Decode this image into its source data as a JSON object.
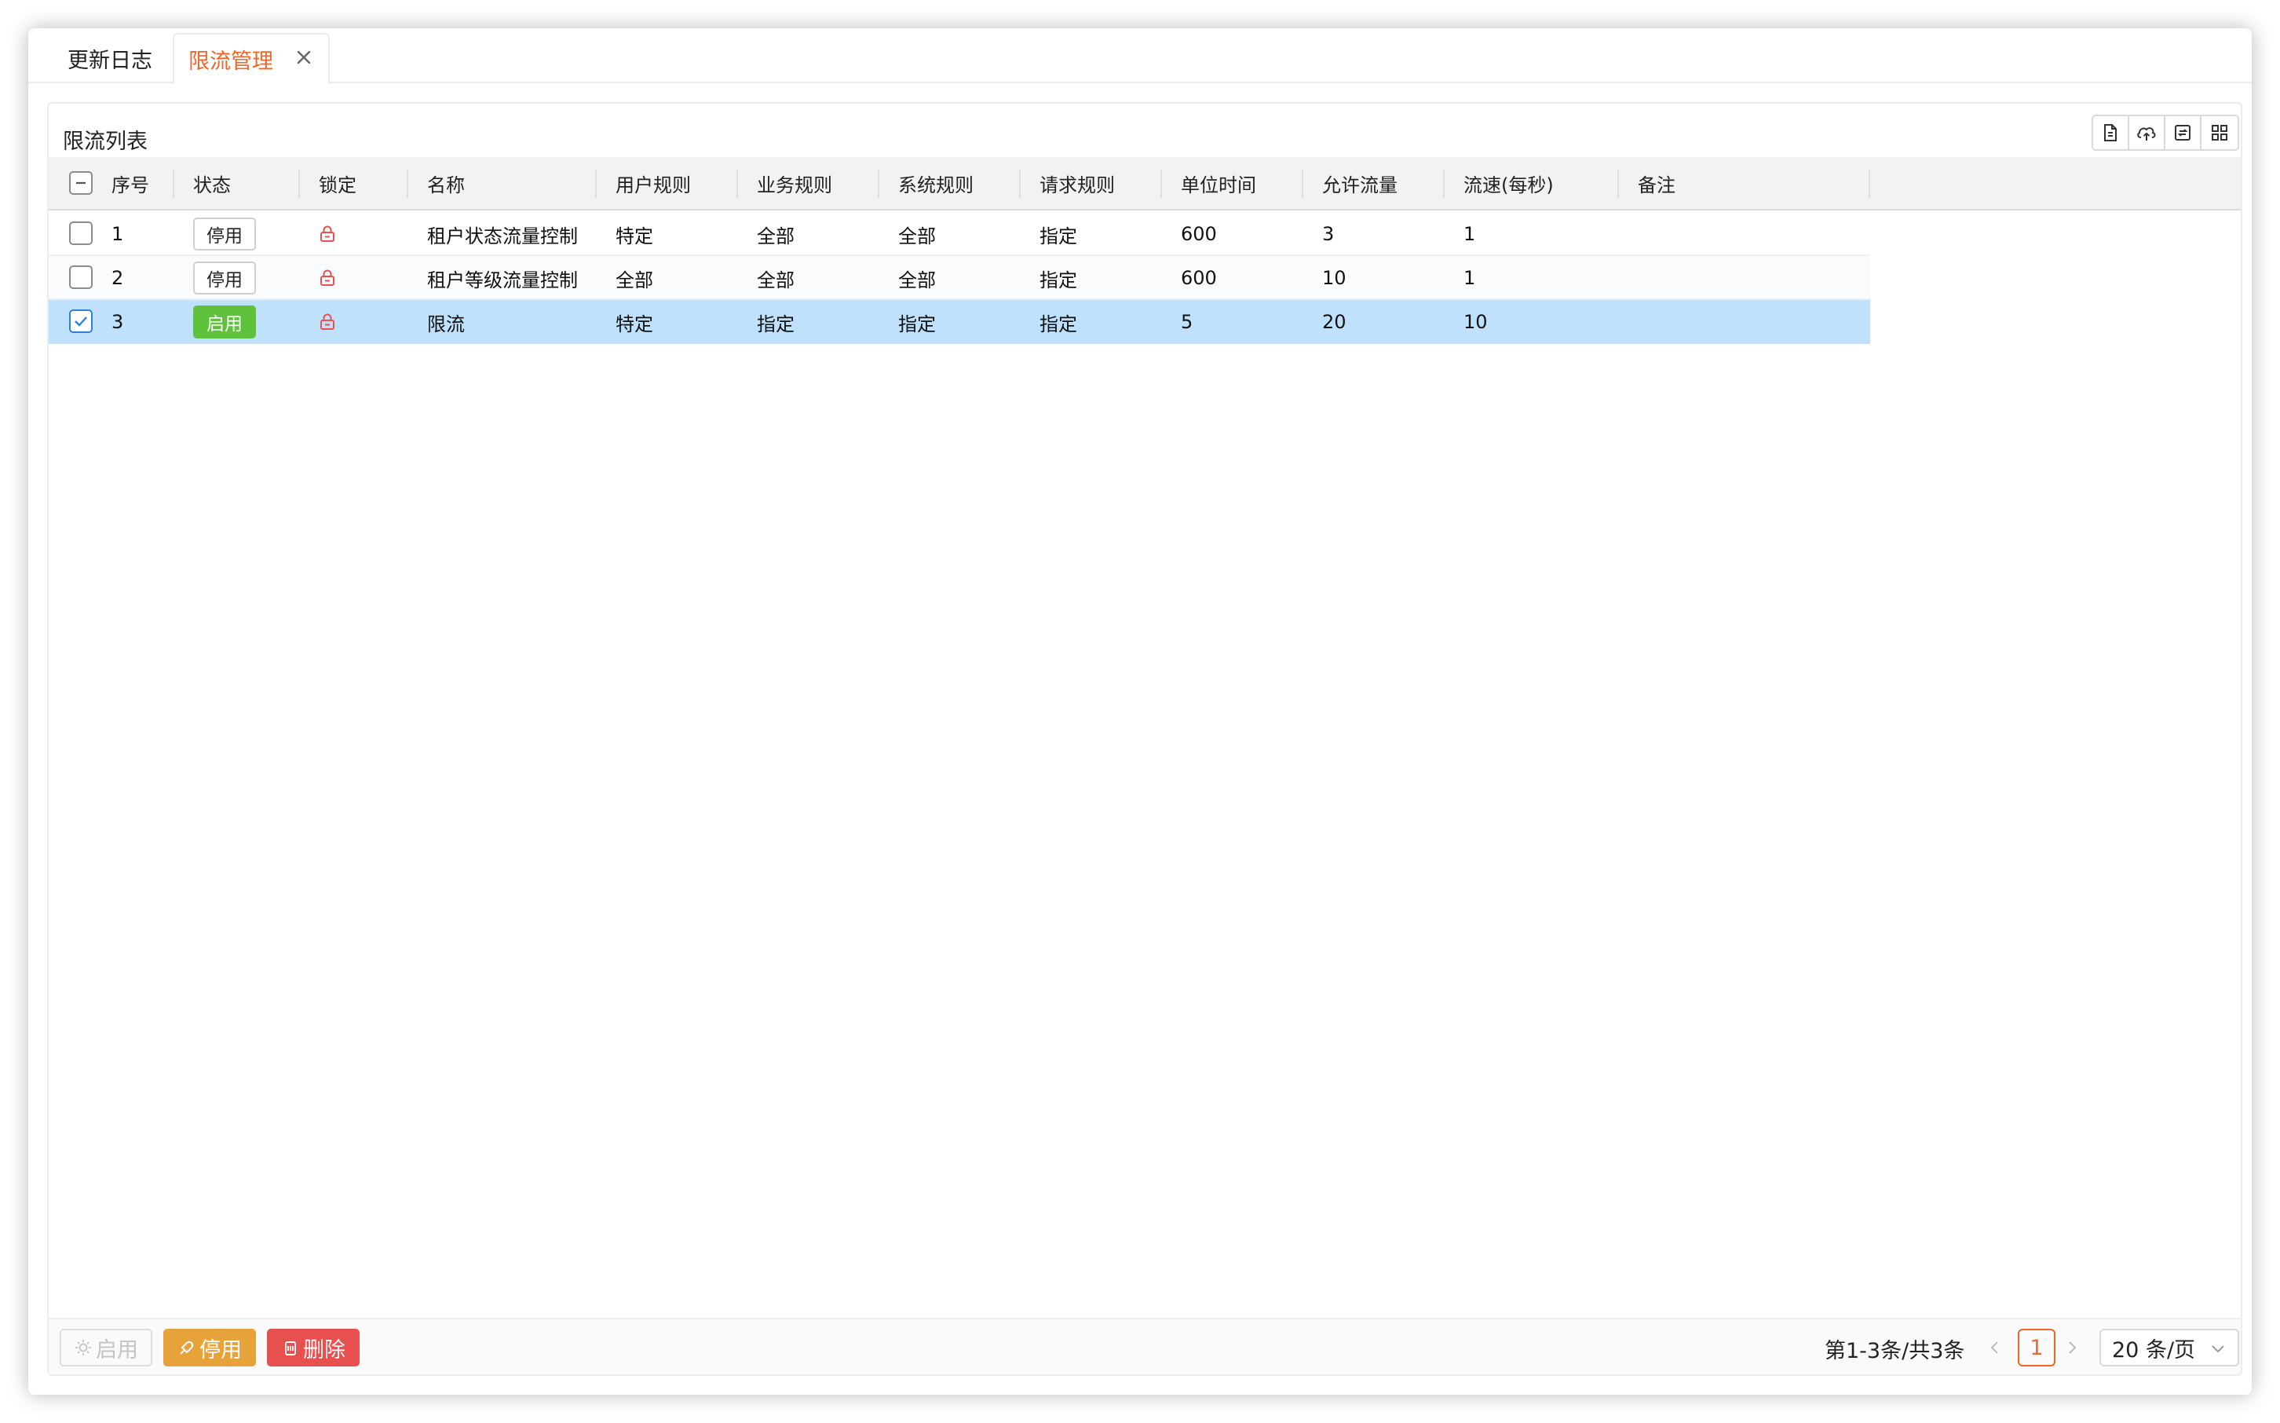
{
  "tabs": [
    {
      "label": "更新日志",
      "active": false
    },
    {
      "label": "限流管理",
      "active": true
    }
  ],
  "panel": {
    "title": "限流列表",
    "toolbar_icons": [
      "export-file-icon",
      "cloud-icon",
      "refresh-icon",
      "grid-icon"
    ]
  },
  "table": {
    "columns": [
      "序号",
      "状态",
      "锁定",
      "名称",
      "用户规则",
      "业务规则",
      "系统规则",
      "请求规则",
      "单位时间",
      "允许流量",
      "流速(每秒)",
      "备注"
    ],
    "header_checkbox": "indeterminate",
    "rows": [
      {
        "selected": false,
        "no": "1",
        "status": "停用",
        "status_on": false,
        "locked": true,
        "name": "租户状态流量控制",
        "user_rule": "特定",
        "biz_rule": "全部",
        "sys_rule": "全部",
        "req_rule": "指定",
        "unit_time": "600",
        "allowed": "3",
        "rate": "1",
        "note": ""
      },
      {
        "selected": false,
        "no": "2",
        "status": "停用",
        "status_on": false,
        "locked": true,
        "name": "租户等级流量控制",
        "user_rule": "全部",
        "biz_rule": "全部",
        "sys_rule": "全部",
        "req_rule": "指定",
        "unit_time": "600",
        "allowed": "10",
        "rate": "1",
        "note": ""
      },
      {
        "selected": true,
        "no": "3",
        "status": "启用",
        "status_on": true,
        "locked": true,
        "name": "限流",
        "user_rule": "特定",
        "biz_rule": "指定",
        "sys_rule": "指定",
        "req_rule": "指定",
        "unit_time": "5",
        "allowed": "20",
        "rate": "10",
        "note": ""
      }
    ]
  },
  "footer": {
    "enable_label": "启用",
    "disable_label": "停用",
    "delete_label": "删除",
    "summary": "第1-3条/共3条",
    "current_page": "1",
    "page_size": "20 条/页"
  },
  "colors": {
    "accent": "#f0662a",
    "selected_row": "#bfe1fb",
    "status_on": "#5fc23c",
    "lock": "#e8504f",
    "btn_disable": "#e8a23a",
    "btn_delete": "#e8504f"
  }
}
